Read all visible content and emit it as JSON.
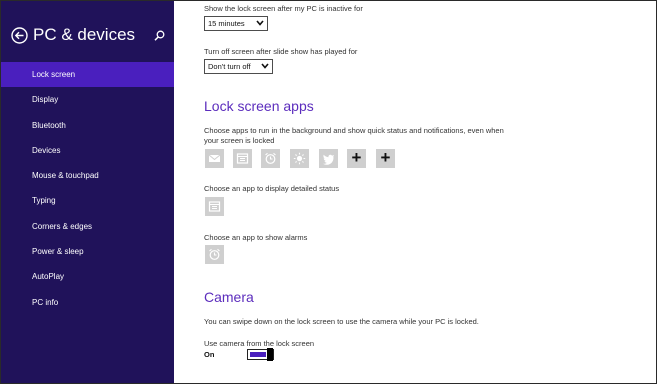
{
  "sidebar": {
    "title": "PC & devices",
    "items": [
      {
        "label": "Lock screen"
      },
      {
        "label": "Display"
      },
      {
        "label": "Bluetooth"
      },
      {
        "label": "Devices"
      },
      {
        "label": "Mouse & touchpad"
      },
      {
        "label": "Typing"
      },
      {
        "label": "Corners & edges"
      },
      {
        "label": "Power & sleep"
      },
      {
        "label": "AutoPlay"
      },
      {
        "label": "PC info"
      }
    ],
    "active_index": 0,
    "colors": {
      "background": "#20125a",
      "active": "#4a1fbe"
    }
  },
  "main": {
    "lock_inactive_label": "Show the lock screen after my PC is inactive for",
    "lock_inactive_value": "15 minutes",
    "slideshow_label": "Turn off screen after slide show has played for",
    "slideshow_value": "Don't turn off",
    "lock_apps_heading": "Lock screen apps",
    "lock_apps_desc": "Choose apps to run in the background and show quick status and notifications, even when your screen is locked",
    "quick_status_apps": [
      {
        "icon": "mail-icon"
      },
      {
        "icon": "calendar-icon"
      },
      {
        "icon": "alarm-icon"
      },
      {
        "icon": "weather-icon"
      },
      {
        "icon": "twitter-icon"
      },
      {
        "icon": "add-icon"
      },
      {
        "icon": "add-icon"
      }
    ],
    "add_symbol": "+",
    "detailed_status_label": "Choose an app to display detailed status",
    "detailed_status_app": {
      "icon": "calendar-icon"
    },
    "alarms_label": "Choose an app to show alarms",
    "alarms_app": {
      "icon": "alarm-icon"
    },
    "camera_heading": "Camera",
    "camera_desc": "You can swipe down on the lock screen to use the camera while your PC is locked.",
    "camera_toggle_label": "Use camera from the lock screen",
    "camera_toggle_state": "On",
    "accent_color": "#5c2dbd"
  }
}
